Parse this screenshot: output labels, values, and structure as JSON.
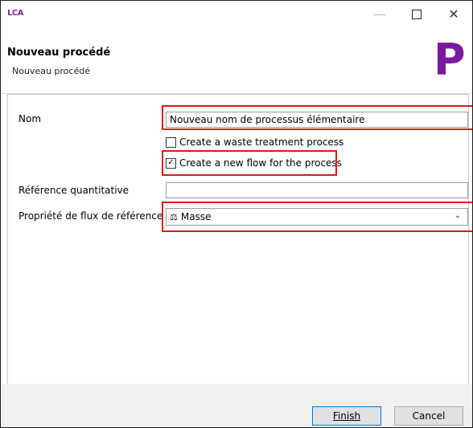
{
  "window": {
    "app_icon": "LCA",
    "minimize_icon": "minimize-icon",
    "maximize_icon": "maximize-icon",
    "close_icon": "close-icon"
  },
  "header": {
    "title": "Nouveau procédé",
    "subtitle": "Nouveau procédé",
    "logo_letter": "P",
    "logo_color": "#7a1aa0"
  },
  "form": {
    "name_label": "Nom",
    "name_value": "Nouveau nom de processus élémentaire",
    "waste_checkbox_label": "Create a waste treatment process",
    "waste_checked": false,
    "newflow_checkbox_label": "Create a new flow for the process",
    "newflow_checked": true,
    "quantitative_ref_label": "Référence quantitative",
    "quantitative_ref_value": "",
    "flow_property_label": "Propriété de flux de référence",
    "flow_property_value": "Masse",
    "flow_property_icon": "scale-icon"
  },
  "buttons": {
    "finish": "Finish",
    "cancel": "Cancel"
  },
  "annotation_color": "#e01818"
}
